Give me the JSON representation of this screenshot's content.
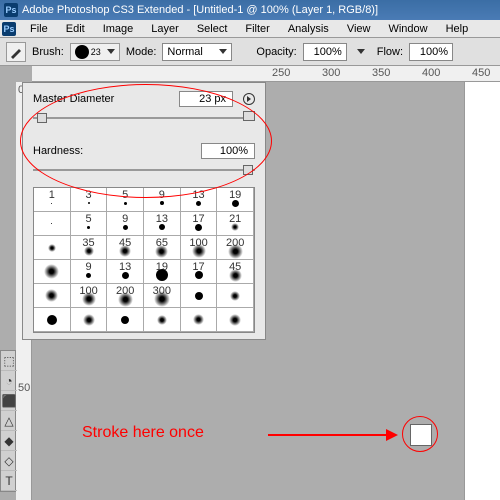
{
  "title": "Adobe Photoshop CS3 Extended - [Untitled-1 @ 100% (Layer 1, RGB/8)]",
  "ps_icon": "Ps",
  "menu": [
    "File",
    "Edit",
    "Image",
    "Layer",
    "Select",
    "Filter",
    "Analysis",
    "View",
    "Window",
    "Help"
  ],
  "optbar": {
    "brush_label": "Brush:",
    "brush_size": "23",
    "mode_label": "Mode:",
    "mode_value": "Normal",
    "opacity_label": "Opacity:",
    "opacity_value": "100%",
    "flow_label": "Flow:",
    "flow_value": "100%"
  },
  "panel": {
    "master_label": "Master Diameter",
    "master_value": "23 px",
    "hardness_label": "Hardness:",
    "hardness_value": "100%",
    "presets": [
      [
        {
          "n": "1",
          "d": 1,
          "h": true
        },
        {
          "n": "3",
          "d": 2,
          "h": true
        },
        {
          "n": "5",
          "d": 3,
          "h": true
        },
        {
          "n": "9",
          "d": 4,
          "h": true
        },
        {
          "n": "13",
          "d": 5,
          "h": true
        },
        {
          "n": "19",
          "d": 7,
          "h": true
        }
      ],
      [
        {
          "n": "",
          "d": 1,
          "h": true
        },
        {
          "n": "5",
          "d": 3,
          "h": true
        },
        {
          "n": "9",
          "d": 5,
          "h": true
        },
        {
          "n": "13",
          "d": 6,
          "h": true
        },
        {
          "n": "17",
          "d": 7,
          "h": true
        },
        {
          "n": "21",
          "d": 8,
          "h": false
        }
      ],
      [
        {
          "n": "",
          "d": 8,
          "h": false
        },
        {
          "n": "35",
          "d": 10,
          "h": false
        },
        {
          "n": "45",
          "d": 12,
          "h": false
        },
        {
          "n": "65",
          "d": 13,
          "h": false
        },
        {
          "n": "100",
          "d": 14,
          "h": false
        },
        {
          "n": "200",
          "d": 15,
          "h": false
        }
      ],
      [
        {
          "n": "",
          "d": 15,
          "h": false
        },
        {
          "n": "9",
          "d": 5,
          "h": true
        },
        {
          "n": "13",
          "d": 7,
          "h": true
        },
        {
          "n": "19",
          "d": 12,
          "h": true
        },
        {
          "n": "17",
          "d": 8,
          "h": true
        },
        {
          "n": "45",
          "d": 13,
          "h": false
        }
      ],
      [
        {
          "n": "",
          "d": 13,
          "h": false
        },
        {
          "n": "100",
          "d": 14,
          "h": false
        },
        {
          "n": "200",
          "d": 15,
          "h": false
        },
        {
          "n": "300",
          "d": 16,
          "h": false
        },
        {
          "n": "",
          "d": 8,
          "h": true
        },
        {
          "n": "",
          "d": 10,
          "h": false
        }
      ],
      [
        {
          "n": "",
          "d": 10,
          "h": true
        },
        {
          "n": "",
          "d": 12,
          "h": false
        },
        {
          "n": "",
          "d": 8,
          "h": true
        },
        {
          "n": "",
          "d": 10,
          "h": false
        },
        {
          "n": "",
          "d": 11,
          "h": false
        },
        {
          "n": "",
          "d": 12,
          "h": false
        }
      ]
    ]
  },
  "ruler_h": [
    "250",
    "300",
    "350",
    "400",
    "450"
  ],
  "ruler_v": [
    "0",
    "50"
  ],
  "tools": [
    "⬚",
    "◔",
    "⬛",
    "△",
    "◆",
    "◇",
    "T"
  ],
  "annotation": "Stroke here once"
}
